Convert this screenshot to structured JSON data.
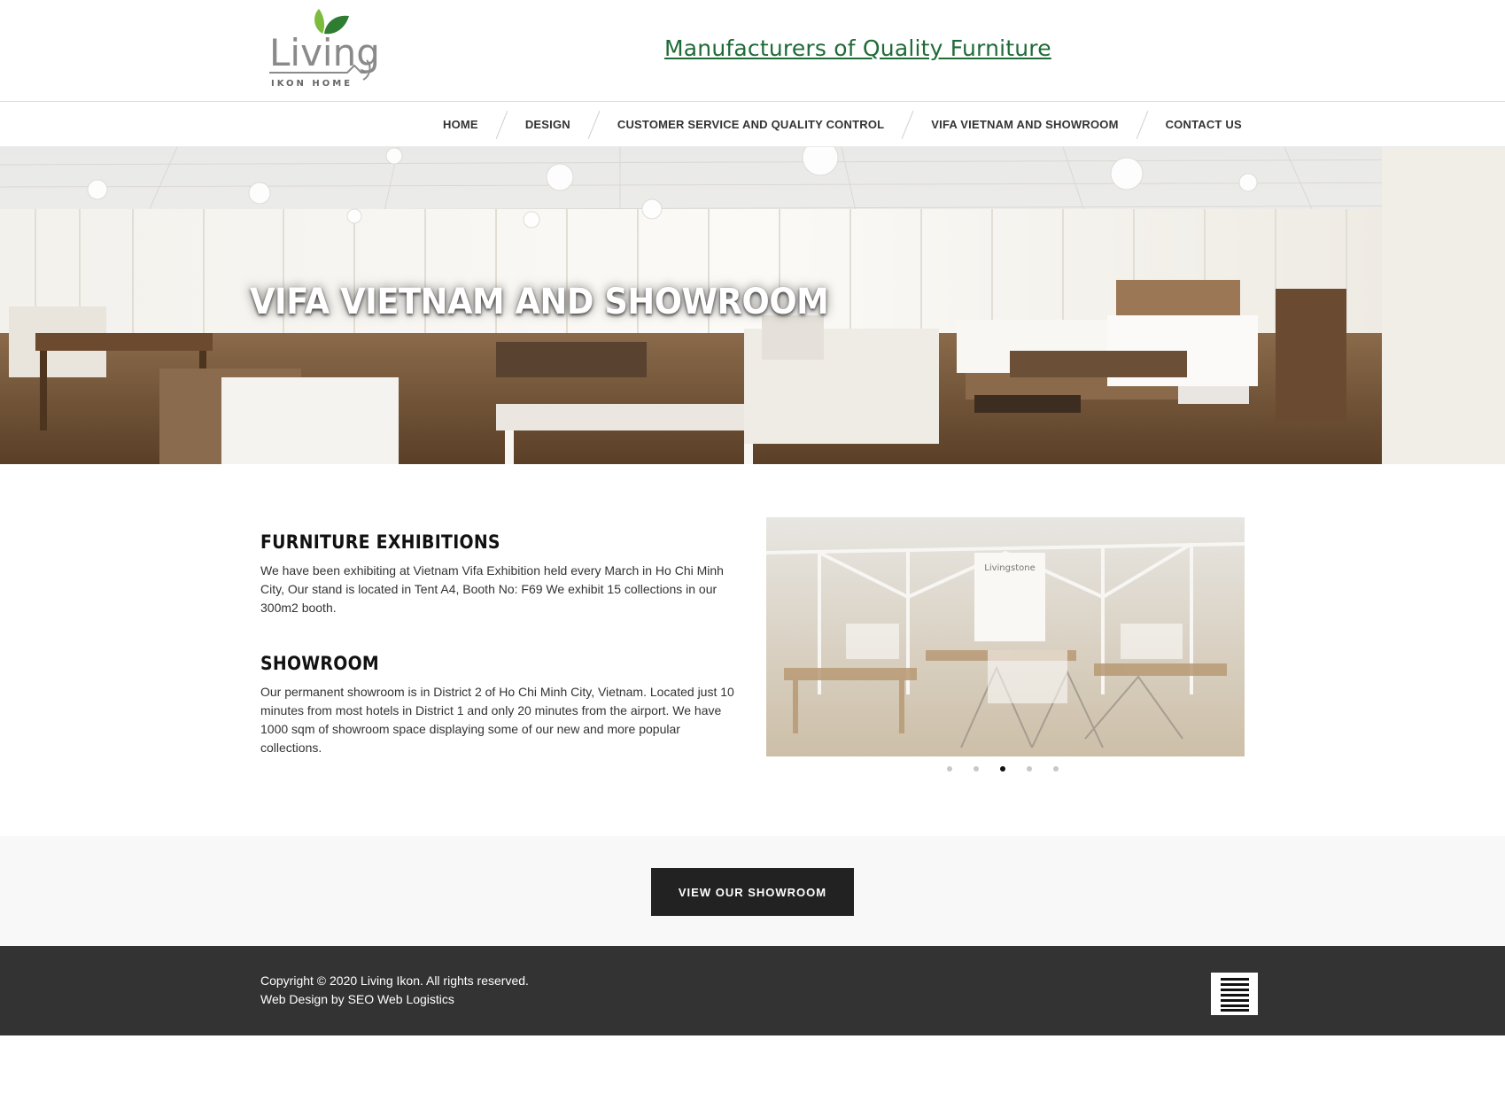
{
  "header": {
    "logo": {
      "word": "Living",
      "sub": "IKON HOME",
      "icon": "leaf-logo-icon"
    },
    "tagline": "Manufacturers of Quality Furniture",
    "tagline_color": "#1f6b38"
  },
  "nav": {
    "items": [
      {
        "label": "HOME"
      },
      {
        "label": "DESIGN"
      },
      {
        "label": "CUSTOMER SERVICE AND QUALITY CONTROL"
      },
      {
        "label": "VIFA VIETNAM AND SHOWROOM"
      },
      {
        "label": "CONTACT US"
      }
    ]
  },
  "hero": {
    "title": "VIFA VIETNAM AND SHOWROOM"
  },
  "content": {
    "exhibitions": {
      "title": "FURNITURE EXHIBITIONS",
      "text": "We have been exhibiting at Vietnam Vifa Exhibition held every March in Ho Chi Minh City, Our stand is located in Tent A4, Booth No: F69 We exhibit 15 collections in our 300m2 booth."
    },
    "showroom": {
      "title": "SHOWROOM",
      "text": "Our permanent showroom is in District 2 of Ho Chi Minh City, Vietnam. Located just 10 minutes from most hotels in District 1 and only 20 minutes from the airport. We have 1000 sqm of showroom space displaying some of our new and more popular collections."
    },
    "slider": {
      "sign_text": "Livingstone",
      "active_index": 2,
      "count": 5
    }
  },
  "cta": {
    "label": "VIEW OUR SHOWROOM"
  },
  "footer": {
    "copyright": "Copyright © 2020 Living Ikon. All rights reserved.",
    "credit": "Web Design by SEO Web Logistics",
    "icon": "hamburger-menu-icon"
  }
}
